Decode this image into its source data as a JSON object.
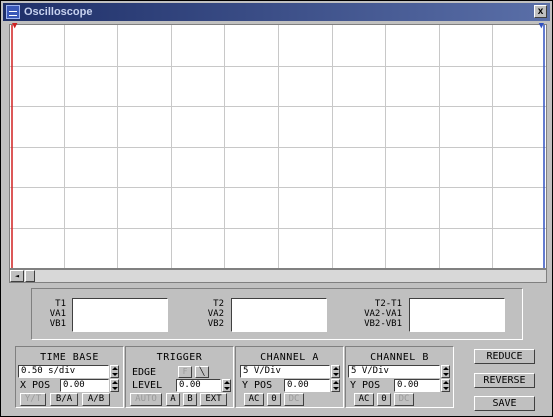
{
  "window": {
    "title": "Oscilloscope",
    "close_glyph": "x"
  },
  "screen": {
    "markers": [
      "▼",
      "▼"
    ]
  },
  "scrollbar": {
    "left_arrow": "◄"
  },
  "readouts": {
    "group1": {
      "labels": [
        "T1",
        "VA1",
        "VB1"
      ],
      "value": ""
    },
    "group2": {
      "labels": [
        "T2",
        "VA2",
        "VB2"
      ],
      "value": ""
    },
    "group3": {
      "labels": [
        "T2-T1",
        "VA2-VA1",
        "VB2-VB1"
      ],
      "value": ""
    }
  },
  "time_base": {
    "title": "TIME BASE",
    "scale": "0.50 s/div",
    "xpos_label": "X POS",
    "xpos": "0.00",
    "buttons": [
      "Y/T",
      "B/A",
      "A/B"
    ]
  },
  "trigger": {
    "title": "TRIGGER",
    "edge_label": "EDGE",
    "edge_buttons": [
      "F",
      "╲"
    ],
    "level_label": "LEVEL",
    "level": "0.00",
    "buttons": [
      "AUTO",
      "A",
      "B",
      "EXT"
    ]
  },
  "channel_a": {
    "title": "CHANNEL A",
    "scale": "5 V/Div",
    "ypos_label": "Y POS",
    "ypos": "0.00",
    "buttons": [
      "AC",
      "0",
      "DC"
    ]
  },
  "channel_b": {
    "title": "CHANNEL B",
    "scale": "5 V/Div",
    "ypos_label": "Y POS",
    "ypos": "0.00",
    "buttons": [
      "AC",
      "0",
      "DC"
    ]
  },
  "actions": {
    "reduce": "REDUCE",
    "reverse": "REVERSE",
    "save": "SAVE"
  },
  "colors": {
    "trace_a": "#d02020",
    "trace_b": "#3050c0",
    "grid": "#c8c8c8",
    "title_bar": "#1e2f68"
  }
}
